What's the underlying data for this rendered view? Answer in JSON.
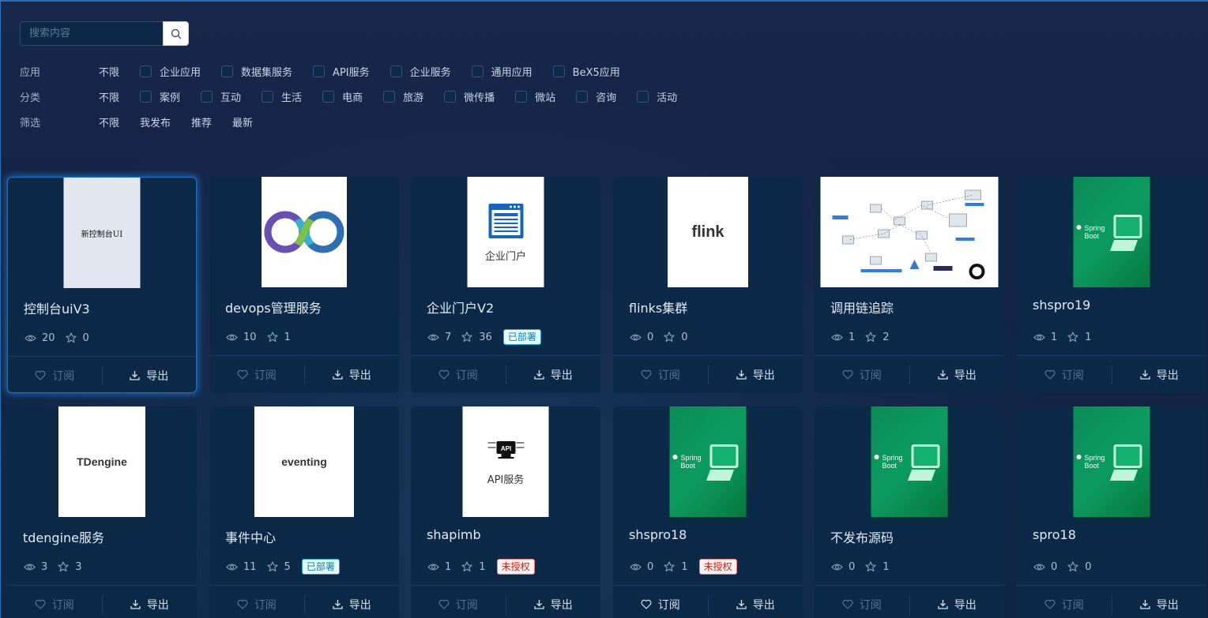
{
  "search": {
    "placeholder": "搜索内容"
  },
  "filters": {
    "app": {
      "label": "应用",
      "all": "不限",
      "options": [
        "企业应用",
        "数据集服务",
        "API服务",
        "企业服务",
        "通用应用",
        "BeX5应用"
      ]
    },
    "category": {
      "label": "分类",
      "all": "不限",
      "options": [
        "案例",
        "互动",
        "生活",
        "电商",
        "旅游",
        "微传播",
        "微站",
        "咨询",
        "活动"
      ]
    },
    "screen": {
      "label": "筛选",
      "options": [
        "不限",
        "我发布",
        "推荐",
        "最新"
      ]
    }
  },
  "actions": {
    "subscribe": "订阅",
    "export": "导出"
  },
  "badges": {
    "deployed": "已部署",
    "unauthorized": "未授权"
  },
  "cards": [
    {
      "title": "控制台uiV3",
      "views": "20",
      "stars": "0",
      "badge": "",
      "thumb": "新控制台UI",
      "icon": "text-thumb",
      "active": true
    },
    {
      "title": "devops管理服务",
      "views": "10",
      "stars": "1",
      "badge": "",
      "thumb": "",
      "icon": "devops-infinity"
    },
    {
      "title": "企业门户V2",
      "views": "7",
      "stars": "36",
      "badge": "已部署",
      "thumb": "企业门户",
      "icon": "portal-window"
    },
    {
      "title": "flinks集群",
      "views": "0",
      "stars": "0",
      "badge": "",
      "thumb": "flink",
      "icon": "word-thumb"
    },
    {
      "title": "调用链追踪",
      "views": "1",
      "stars": "2",
      "badge": "",
      "thumb": "",
      "icon": "trace-diagram"
    },
    {
      "title": "shspro19",
      "views": "1",
      "stars": "1",
      "badge": "",
      "thumb": "Spring Boot",
      "icon": "spring-boot"
    },
    {
      "title": "tdengine服务",
      "views": "3",
      "stars": "3",
      "badge": "",
      "thumb": "TDengine",
      "icon": "word-thumb"
    },
    {
      "title": "事件中心",
      "views": "11",
      "stars": "5",
      "badge": "已部署",
      "thumb": "eventing",
      "icon": "word-thumb"
    },
    {
      "title": "shapimb",
      "views": "1",
      "stars": "1",
      "badge": "未授权",
      "thumb": "API服务",
      "icon": "api-chip",
      "thumb_top": "API"
    },
    {
      "title": "shspro18",
      "views": "0",
      "stars": "1",
      "badge": "未授权",
      "thumb": "Spring Boot",
      "icon": "spring-boot",
      "sub_on": true
    },
    {
      "title": "不发布源码",
      "views": "0",
      "stars": "1",
      "badge": "",
      "thumb": "Spring Boot",
      "icon": "spring-boot"
    },
    {
      "title": "spro18",
      "views": "0",
      "stars": "0",
      "badge": "",
      "thumb": "Spring Boot",
      "icon": "spring-boot"
    }
  ]
}
